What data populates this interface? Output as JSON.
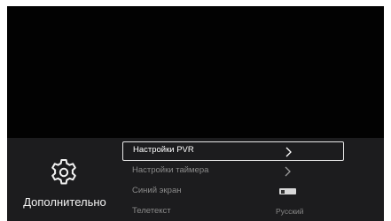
{
  "category": {
    "icon": "gear-icon",
    "label": "Дополнительно"
  },
  "menu": {
    "items": [
      {
        "label": "Настройки PVR",
        "control": "chevron-right-icon",
        "selected": true
      },
      {
        "label": "Настройки таймера",
        "control": "chevron-right-icon",
        "selected": false
      },
      {
        "label": "Синий экран",
        "control": "toggle",
        "toggle_on": false,
        "selected": false
      },
      {
        "label": "Телетекст",
        "control": "value",
        "value": "Русский",
        "selected": false
      }
    ]
  },
  "colors": {
    "background": "#020202",
    "panel": "#1c1c1e",
    "text_active": "#ffffff",
    "text_inactive": "#8a8a8a",
    "focus_border": "#e8e8e8"
  }
}
